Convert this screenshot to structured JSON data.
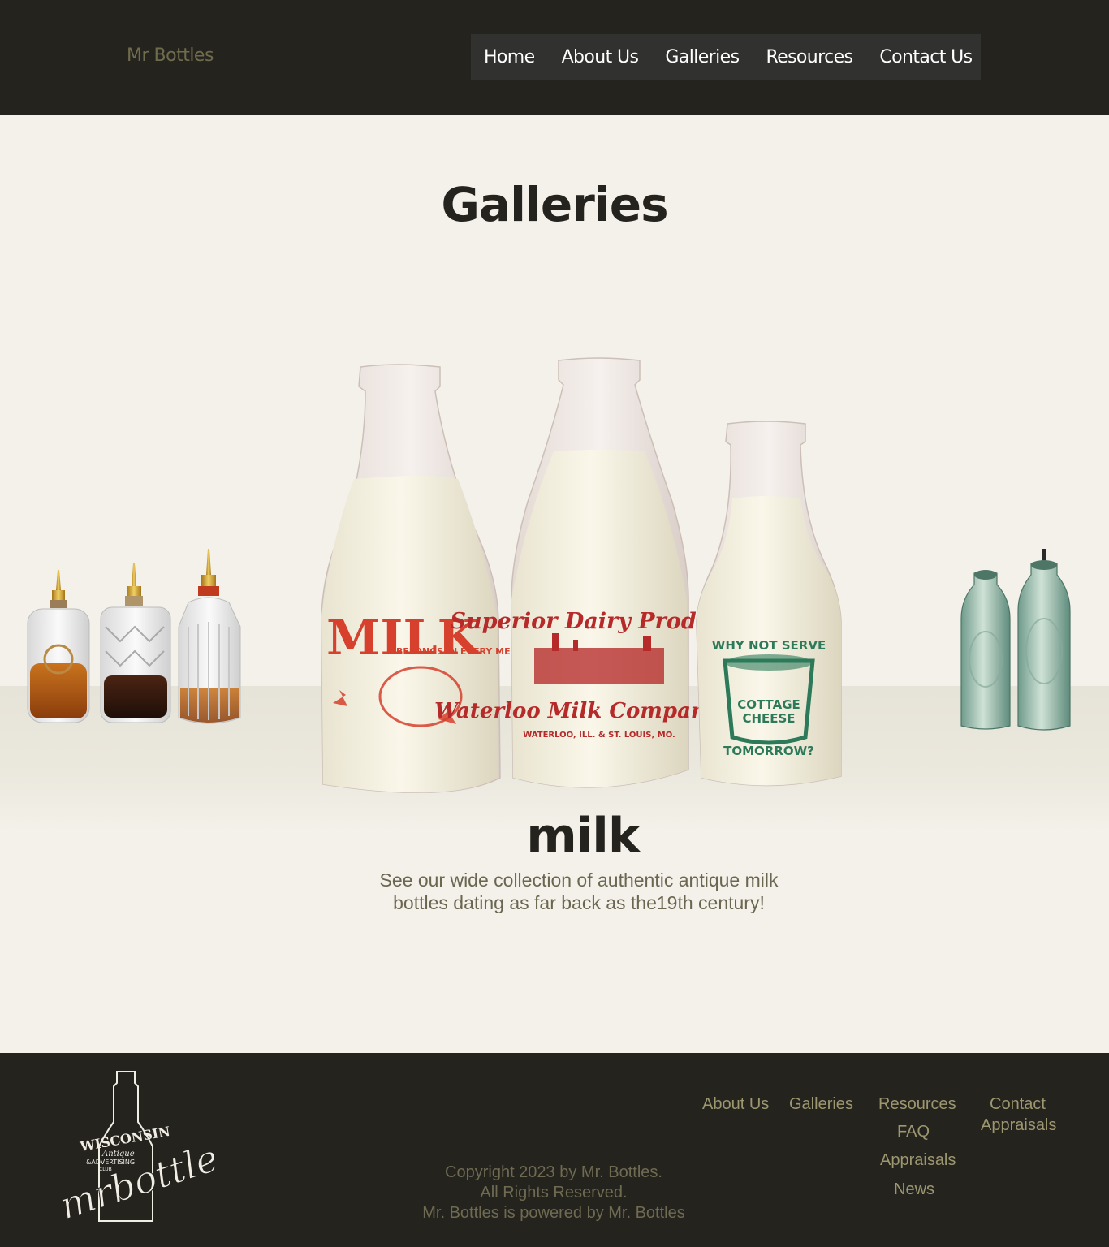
{
  "header": {
    "brand": "Mr Bottles",
    "nav": [
      "Home",
      "About Us",
      "Galleries",
      "Resources",
      "Contact Us"
    ]
  },
  "main": {
    "title": "Galleries",
    "gallery": {
      "name": "milk",
      "description": "See our wide collection of authentic antique milk bottles dating as far back as the19th century!",
      "images": {
        "left": "bitters-bottles",
        "center": "milk-bottles",
        "right": "hutchinson-soda-bottles"
      },
      "labels": {
        "bottle1_line1": "MILK",
        "bottle1_line2": "BELONGS IN EVERY MEAL",
        "bottle2_line1": "Superior Dairy Products",
        "bottle2_line2": "Waterloo Milk Company Inc",
        "bottle2_line3": "WATERLOO, ILL. & ST. LOUIS, MO.",
        "bottle3_line1": "WHY NOT SERVE",
        "bottle3_line2": "COTTAGE",
        "bottle3_line3": "CHEESE",
        "bottle3_line4": "TOMORROW?"
      }
    }
  },
  "footer": {
    "logo": {
      "line1": "WISCONSIN",
      "line2": "Antique",
      "line3": "&ADVERTISING",
      "line4": "CLUB",
      "script": "mrbottles"
    },
    "links": {
      "about": "About Us",
      "galleries": "Galleries",
      "resources": "Resources",
      "faq": "FAQ",
      "appraisals": "Appraisals",
      "news": "News",
      "contact": "Contact",
      "contact_appraisals": "Appraisals"
    },
    "copyright": [
      "Copyright 2023 by Mr. Bottles.",
      "All Rights Reserved.",
      "Mr. Bottles is powered by Mr. Bottles"
    ]
  },
  "colors": {
    "header_bg": "#25231e",
    "nav_bg": "#313130",
    "page_bg": "#f4f1ea",
    "footer_link": "#9d9770",
    "milk_red": "#cc3a2a",
    "milk_green": "#2d7a5a"
  }
}
